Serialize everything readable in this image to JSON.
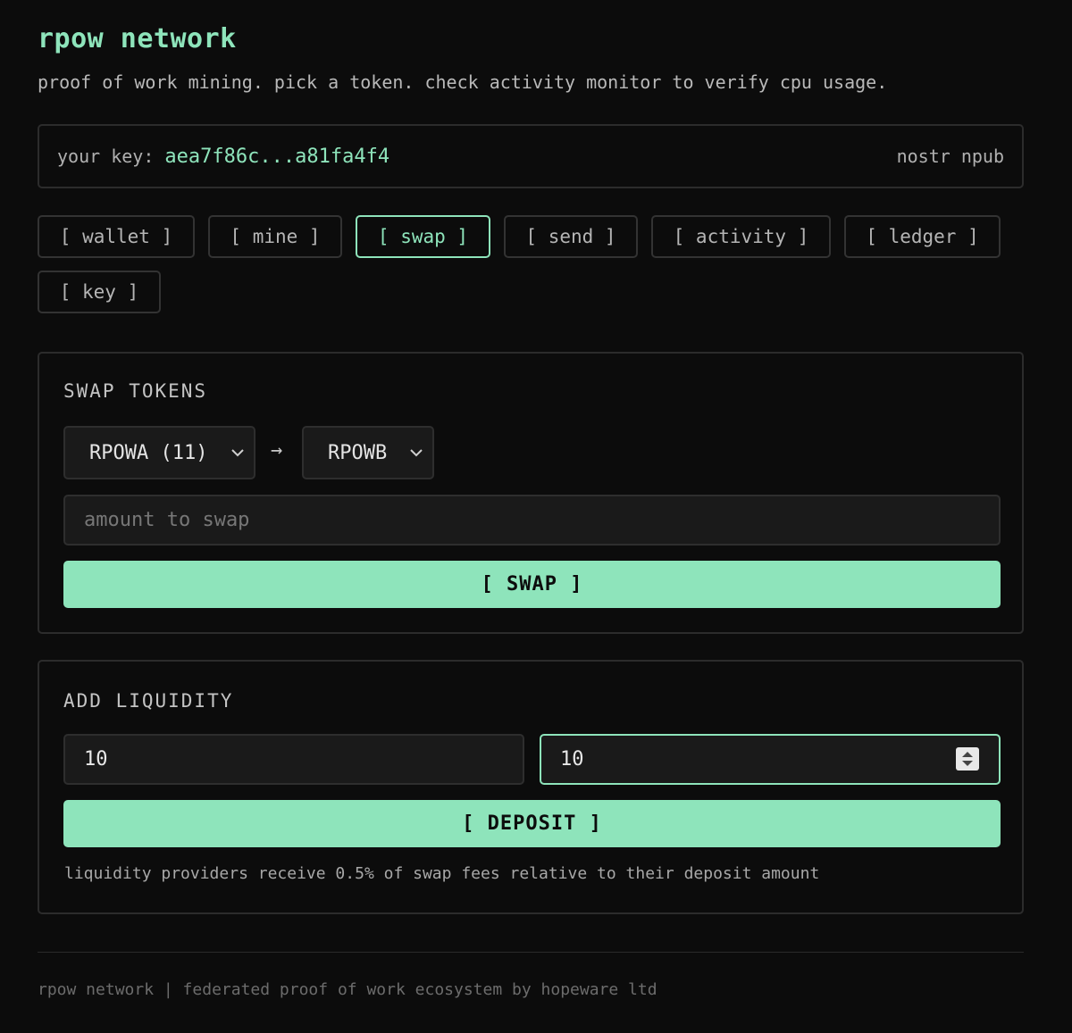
{
  "header": {
    "title": "rpow network",
    "subtitle": "proof of work mining. pick a token. check activity monitor to verify cpu usage."
  },
  "key": {
    "label": "your key:",
    "value": "aea7f86c...a81fa4f4",
    "type": "nostr npub"
  },
  "tabs": [
    {
      "label": "[ wallet ]",
      "active": false
    },
    {
      "label": "[ mine ]",
      "active": false
    },
    {
      "label": "[ swap ]",
      "active": true
    },
    {
      "label": "[ send ]",
      "active": false
    },
    {
      "label": "[ activity ]",
      "active": false
    },
    {
      "label": "[ ledger ]",
      "active": false
    },
    {
      "label": "[ key ]",
      "active": false
    }
  ],
  "swap": {
    "heading": "SWAP TOKENS",
    "from_token": "RPOWA (11)",
    "arrow": "→",
    "to_token": "RPOWB",
    "amount_placeholder": "amount to swap",
    "button_label": "[ SWAP ]"
  },
  "liquidity": {
    "heading": "ADD LIQUIDITY",
    "amount_a": "10",
    "amount_b": "10",
    "button_label": "[ DEPOSIT ]",
    "note": "liquidity providers receive 0.5% of swap fees relative to their deposit amount"
  },
  "footer": {
    "text": "rpow network | federated proof of work ecosystem by hopeware ltd"
  },
  "colors": {
    "accent": "#8ee4bb",
    "background": "#0c0c0c",
    "field_bg": "#1a1a1a"
  }
}
